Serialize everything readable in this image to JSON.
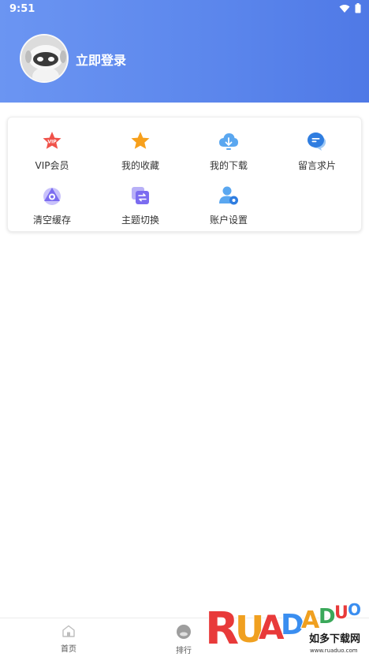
{
  "status_bar": {
    "time": "9:51"
  },
  "header": {
    "login_label": "立即登录"
  },
  "menu": {
    "items": [
      {
        "label": "VIP会员",
        "icon": "vip-star-icon"
      },
      {
        "label": "我的收藏",
        "icon": "star-icon"
      },
      {
        "label": "我的下载",
        "icon": "cloud-download-icon"
      },
      {
        "label": "留言求片",
        "icon": "chat-bubble-icon"
      },
      {
        "label": "清空缓存",
        "icon": "clear-cache-icon"
      },
      {
        "label": "主题切换",
        "icon": "theme-switch-icon"
      },
      {
        "label": "账户设置",
        "icon": "account-settings-icon"
      }
    ]
  },
  "bottom_nav": {
    "items": [
      {
        "label": "首页",
        "icon": "home-icon"
      },
      {
        "label": "排行",
        "icon": "rank-icon"
      }
    ]
  },
  "watermark": {
    "brand": "RUADADUO",
    "name": "如多下载网",
    "url": "www.ruaduo.com"
  },
  "colors": {
    "header_start": "#6b95f2",
    "header_end": "#4f79e6",
    "vip": "#f0524a",
    "favorite": "#f7a01c",
    "download": "#5aa7f0",
    "chat": "#2f7de0",
    "purple": "#7b6cf0"
  }
}
